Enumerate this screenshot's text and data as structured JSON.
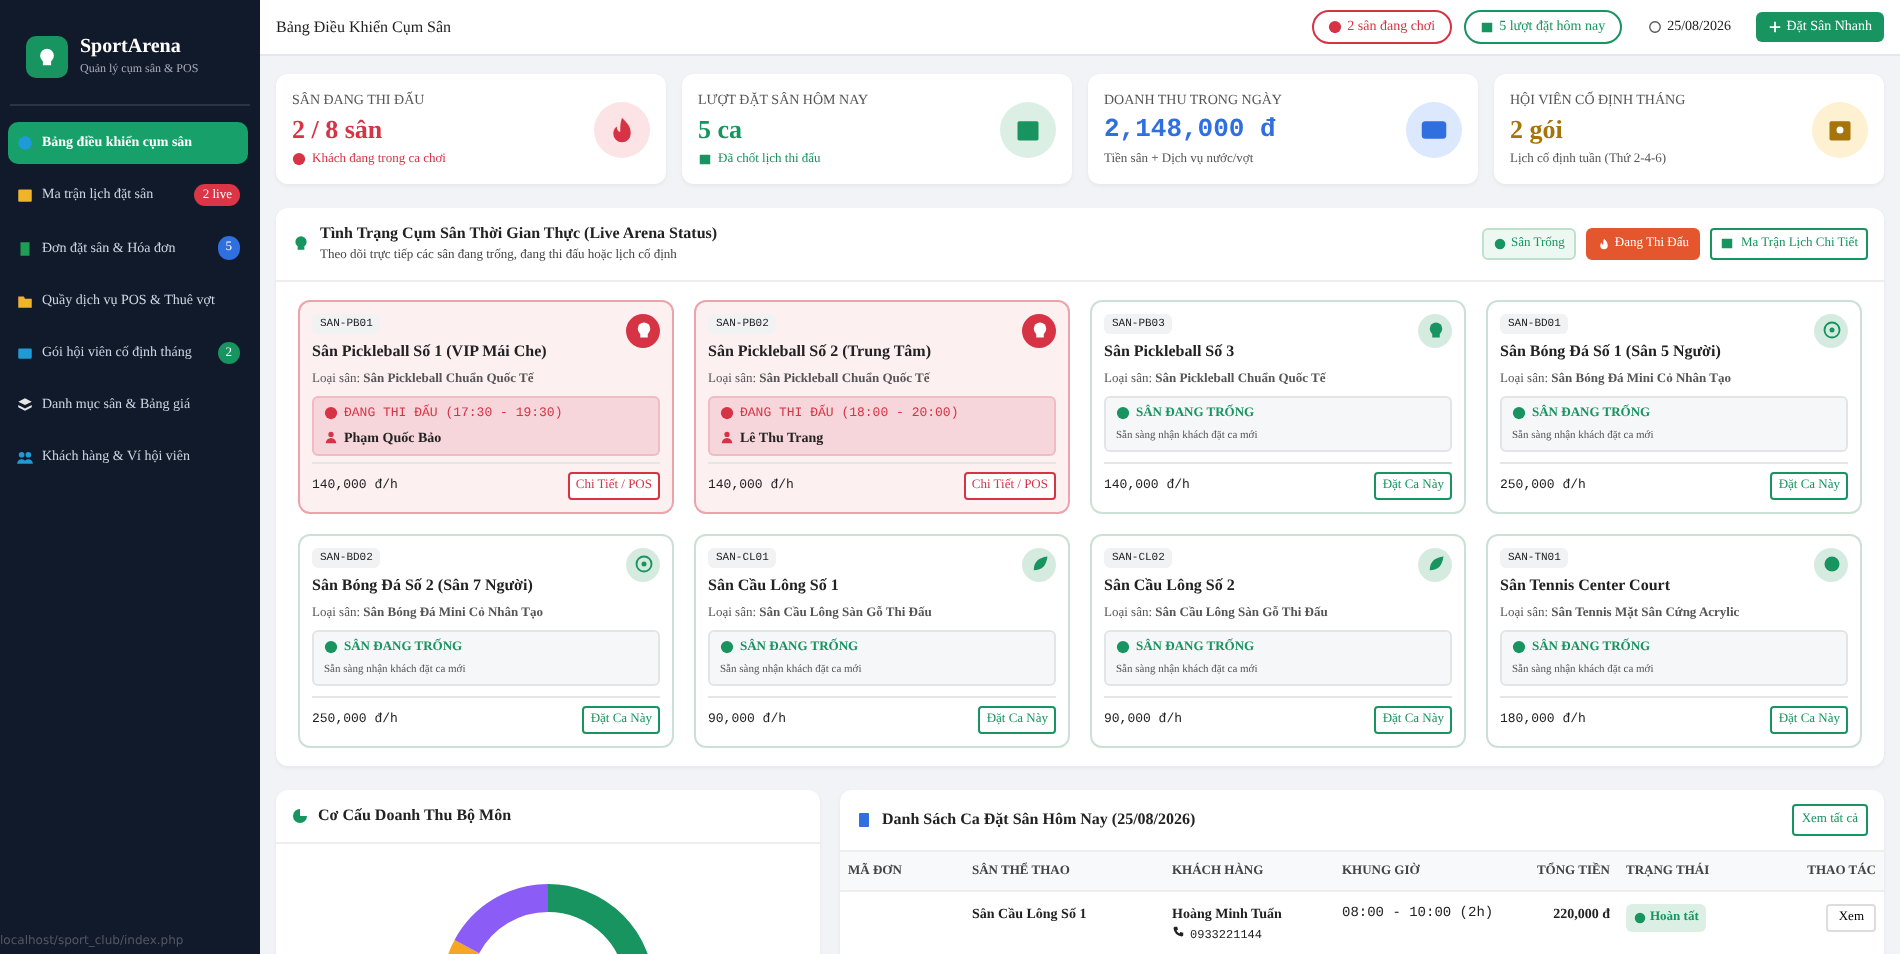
{
  "sidebar": {
    "brand": {
      "title": "SportArena",
      "subtitle": "Quản lý cụm sân & POS"
    },
    "items": [
      {
        "label": "Bảng điều khiển cụm sân",
        "selected": true
      },
      {
        "label": "Ma trận lịch đặt sân",
        "badge": "2 live",
        "color": "#dc3545",
        "selected": false
      },
      {
        "label": "Đơn đặt sân & Hóa đơn",
        "badge": "5",
        "color": "#2f6fe0",
        "selected": false
      },
      {
        "label": "Quầy dịch vụ POS & Thuê vợt",
        "selected": false
      },
      {
        "label": "Gói hội viên cố định tháng",
        "badge": "2",
        "color": "#17945f",
        "selected": false
      },
      {
        "label": "Danh mục sân & Bảng giá",
        "selected": false
      },
      {
        "label": "Khách hàng & Ví hội viên",
        "selected": false
      }
    ],
    "status_url": "localhost/sport_club/index.php"
  },
  "header": {
    "title": "Bảng Điều Khiển Cụm Sân",
    "chips": [
      {
        "text": "2 sân đang chơi",
        "kind": "danger"
      },
      {
        "text": "5 lượt đặt hôm nay",
        "kind": "success"
      }
    ],
    "date": "25/08/2026",
    "button": "Đặt Sân Nhanh"
  },
  "stats": [
    {
      "label": "SÂN ĐANG THI ĐẤU",
      "value": "2 / 8 sân",
      "note": "Khách đang trong ca chơi",
      "kind": "danger"
    },
    {
      "label": "LƯỢT ĐẶT SÂN HÔM NAY",
      "value": "5 ca",
      "note": "Đã chốt lịch thi đấu",
      "kind": "success"
    },
    {
      "label": "DOANH THU TRONG NGÀY",
      "value": "2,148,000 đ",
      "note": "Tiền sân + Dịch vụ nước/vợt",
      "kind": "primary"
    },
    {
      "label": "HỘI VIÊN CỐ ĐỊNH THÁNG",
      "value": "2 gói",
      "note": "Lịch cố định tuần (Thứ 2-4-6)",
      "kind": "warning"
    }
  ],
  "arena": {
    "title": "Tình Trạng Cụm Sân Thời Gian Thực (Live Arena Status)",
    "subtitle": "Theo dõi trực tiếp các sân đang trống, đang thi đấu hoặc lịch cố định",
    "legend": [
      {
        "label": "Sân Trống",
        "kind": "free"
      },
      {
        "label": "Đang Thi Đấu",
        "kind": "busy"
      }
    ],
    "button": "Ma Trận Lịch Chi Tiết",
    "courts": [
      {
        "code": "SAN-PB01",
        "name": "Sân Pickleball Số 1 (VIP Mái Che)",
        "type": "Loại sân: **Sân Pickleball Chuẩn Quốc Tế**",
        "kind": "busy",
        "status_text": "ĐANG THI ĐẤU (17:30 - 19:30)",
        "detail": "Phạm Quốc Bảo",
        "price": "140,000 đ/h",
        "action": "Chi Tiết / POS"
      },
      {
        "code": "SAN-PB02",
        "name": "Sân Pickleball Số 2 (Trung Tâm)",
        "type": "Loại sân: **Sân Pickleball Chuẩn Quốc Tế**",
        "kind": "busy",
        "status_text": "ĐANG THI ĐẤU (18:00 - 20:00)",
        "detail": "Lê Thu Trang",
        "price": "140,000 đ/h",
        "action": "Chi Tiết / POS"
      },
      {
        "code": "SAN-PB03",
        "name": "Sân Pickleball Số 3",
        "type": "Loại sân: **Sân Pickleball Chuẩn Quốc Tế**",
        "kind": "free",
        "status_text": "SÂN ĐANG TRỐNG",
        "detail": "Sẵn sàng nhận khách đặt ca mới",
        "price": "140,000 đ/h",
        "action": "Đặt Ca Này"
      },
      {
        "code": "SAN-BD01",
        "name": "Sân Bóng Đá Số 1 (Sân 5 Người)",
        "type": "Loại sân: **Sân Bóng Đá Mini Cỏ Nhân Tạo**",
        "kind": "free",
        "status_text": "SÂN ĐANG TRỐNG",
        "detail": "Sẵn sàng nhận khách đặt ca mới",
        "price": "250,000 đ/h",
        "action": "Đặt Ca Này"
      },
      {
        "code": "SAN-BD02",
        "name": "Sân Bóng Đá Số 2 (Sân 7 Người)",
        "type": "Loại sân: **Sân Bóng Đá Mini Cỏ Nhân Tạo**",
        "kind": "free",
        "status_text": "SÂN ĐANG TRỐNG",
        "detail": "Sẵn sàng nhận khách đặt ca mới",
        "price": "250,000 đ/h",
        "action": "Đặt Ca Này"
      },
      {
        "code": "SAN-CL01",
        "name": "Sân Cầu Lông Số 1",
        "type": "Loại sân: **Sân Cầu Lông Sàn Gỗ Thi Đấu**",
        "kind": "free",
        "status_text": "SÂN ĐANG TRỐNG",
        "detail": "Sẵn sàng nhận khách đặt ca mới",
        "price": "90,000 đ/h",
        "action": "Đặt Ca Này"
      },
      {
        "code": "SAN-CL02",
        "name": "Sân Cầu Lông Số 2",
        "type": "Loại sân: **Sân Cầu Lông Sàn Gỗ Thi Đấu**",
        "kind": "free",
        "status_text": "SÂN ĐANG TRỐNG",
        "detail": "Sẵn sàng nhận khách đặt ca mới",
        "price": "90,000 đ/h",
        "action": "Đặt Ca Này"
      },
      {
        "code": "SAN-TN01",
        "name": "Sân Tennis Center Court",
        "type": "Loại sân: **Sân Tennis Mặt Sân Cứng Acrylic**",
        "kind": "free",
        "status_text": "SÂN ĐANG TRỐNG",
        "detail": "Sẵn sàng nhận khách đặt ca mới",
        "price": "180,000 đ/h",
        "action": "Đặt Ca Này"
      }
    ]
  },
  "revenue": {
    "title": "Cơ Cấu Doanh Thu Bộ Môn"
  },
  "bookings": {
    "title": "Danh Sách Ca Đặt Sân Hôm Nay (25/08/2026)",
    "button": "Xem tất cả",
    "columns": [
      "MÃ ĐƠN",
      "SÂN THỂ THAO",
      "KHÁCH HÀNG",
      "KHUNG GIỜ",
      "TỔNG TIỀN",
      "TRẠNG THÁI",
      "THAO TÁC"
    ],
    "rows": [
      {
        "court": "Sân Cầu Lông Số 1",
        "customer": "Hoàng Minh Tuấn",
        "phone": "0933221144",
        "time": "08:00 - 10:00 (2h)",
        "total": "220,000 đ",
        "status": "Hoàn tất",
        "kind": "success",
        "action": "Xem"
      }
    ]
  }
}
